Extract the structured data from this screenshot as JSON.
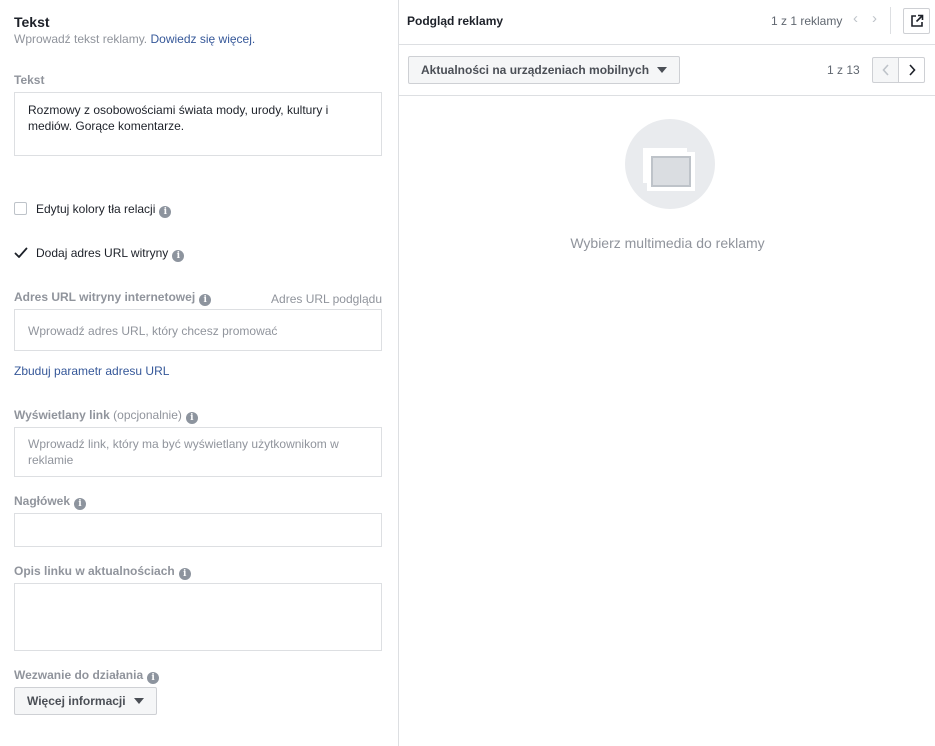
{
  "editor": {
    "section_title": "Tekst",
    "section_subtitle": "Wprowadź tekst reklamy.",
    "learn_more_link": "Dowiedz się więcej.",
    "text_label": "Tekst",
    "text_value": "Rozmowy z osobowościami świata mody, urody, kultury i mediów. Gorące komentarze.",
    "edit_colors_label": "Edytuj kolory tła relacji",
    "edit_colors_checked": false,
    "add_url_label": "Dodaj adres URL witryny",
    "add_url_checked": true,
    "website_url_label": "Adres URL witryny internetowej",
    "preview_url_link": "Adres URL podglądu",
    "website_url_placeholder": "Wprowadź adres URL, który chcesz promować",
    "build_url_param_link": "Zbuduj parametr adresu URL",
    "display_link_label": "Wyświetlany link",
    "display_link_optional": "(opcjonalnie)",
    "display_link_placeholder": "Wprowadź link, który ma być wyświetlany użytkownikom w reklamie",
    "headline_label": "Nagłówek",
    "headline_value": "",
    "news_feed_desc_label": "Opis linku w aktualnościach",
    "news_feed_desc_value": "",
    "cta_label": "Wezwanie do działania",
    "cta_value": "Więcej informacji"
  },
  "preview": {
    "title": "Podgląd reklamy",
    "ad_count": "1 z 1 reklamy",
    "placement_value": "Aktualności na urządzeniach mobilnych",
    "placement_count": "1 z 13",
    "empty_message": "Wybierz multimedia do reklamy"
  },
  "icons": {
    "info": "info-icon",
    "check": "checkmark-icon",
    "external": "external-link-icon",
    "media_placeholder": "media-placeholder-icon"
  },
  "colors": {
    "link": "#365899",
    "muted": "#90949c",
    "border": "#dddfe2"
  }
}
